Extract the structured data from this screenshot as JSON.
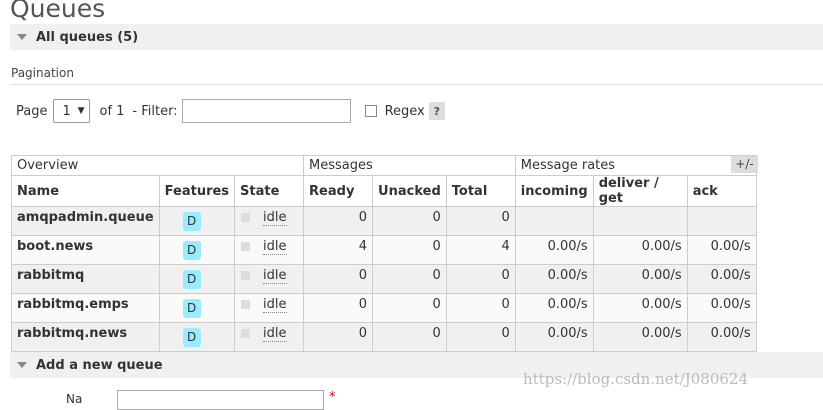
{
  "page": {
    "title": "Queues"
  },
  "all_queues_section": {
    "label": "All queues (5)"
  },
  "pagination": {
    "heading": "Pagination",
    "page_label": "Page",
    "page_value": "1",
    "of_label": "of 1",
    "filter_label": "- Filter:",
    "filter_value": "",
    "regex_label": "Regex",
    "help_label": "?"
  },
  "table": {
    "groups": [
      "Overview",
      "Messages",
      "Message rates"
    ],
    "columns": [
      "Name",
      "Features",
      "State",
      "Ready",
      "Unacked",
      "Total",
      "incoming",
      "deliver / get",
      "ack"
    ],
    "toggle_label": "+/-",
    "rows": [
      {
        "name": "amqpadmin.queue",
        "feature": "D",
        "state": "idle",
        "ready": "0",
        "unacked": "0",
        "total": "0",
        "incoming": "",
        "deliver": "",
        "ack": ""
      },
      {
        "name": "boot.news",
        "feature": "D",
        "state": "idle",
        "ready": "4",
        "unacked": "0",
        "total": "4",
        "incoming": "0.00/s",
        "deliver": "0.00/s",
        "ack": "0.00/s"
      },
      {
        "name": "rabbitmq",
        "feature": "D",
        "state": "idle",
        "ready": "0",
        "unacked": "0",
        "total": "0",
        "incoming": "0.00/s",
        "deliver": "0.00/s",
        "ack": "0.00/s"
      },
      {
        "name": "rabbitmq.emps",
        "feature": "D",
        "state": "idle",
        "ready": "0",
        "unacked": "0",
        "total": "0",
        "incoming": "0.00/s",
        "deliver": "0.00/s",
        "ack": "0.00/s"
      },
      {
        "name": "rabbitmq.news",
        "feature": "D",
        "state": "idle",
        "ready": "0",
        "unacked": "0",
        "total": "0",
        "incoming": "0.00/s",
        "deliver": "0.00/s",
        "ack": "0.00/s"
      }
    ]
  },
  "add_queue_section": {
    "label": "Add a new queue",
    "name_label": "Na",
    "required_mark": "*"
  },
  "watermark": "https://blog.csdn.net/J080624",
  "colors": {
    "feature_badge": "#99ebff",
    "section_bg": "#f0f0f0"
  }
}
